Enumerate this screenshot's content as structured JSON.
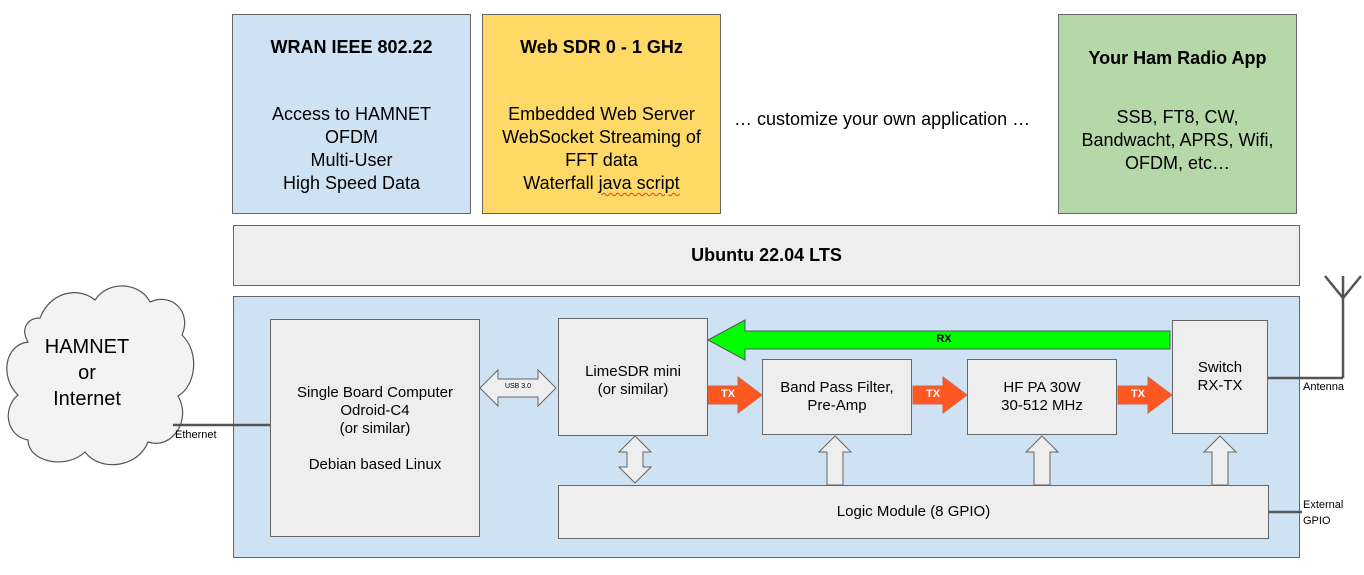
{
  "apps": {
    "wran": {
      "title": "WRAN IEEE 802.22",
      "lines": [
        "Access to HAMNET",
        "OFDM",
        "Multi-User",
        "High Speed Data"
      ],
      "color": "#cfe2f3"
    },
    "websdr": {
      "title": "Web SDR 0 - 1 GHz",
      "lines": [
        "Embedded Web Server",
        "WebSocket Streaming of",
        "FFT data"
      ],
      "last_prefix": "Waterfall ",
      "last_squiggle": "java script",
      "color": "#ffd966"
    },
    "custom_text": "… customize your own application …",
    "ham": {
      "title": "Your Ham Radio App",
      "lines": [
        "SSB, FT8, CW,",
        "Bandwacht, APRS, Wifi,",
        "OFDM, etc…"
      ],
      "color": "#b6d7a8"
    }
  },
  "os": {
    "label": "Ubuntu 22.04 LTS"
  },
  "cloud": {
    "lines": [
      "HAMNET",
      "or",
      "Internet"
    ]
  },
  "hardware": {
    "background": "#cfe2f3",
    "sbc": {
      "lines": [
        "Single Board Computer",
        "Odroid-C4",
        "(or similar)",
        "",
        "Debian based Linux"
      ]
    },
    "limesdr": {
      "lines": [
        "LimeSDR mini",
        "(or similar)"
      ]
    },
    "bpf": {
      "lines": [
        "Band Pass Filter,",
        "Pre-Amp"
      ]
    },
    "pa": {
      "lines": [
        "HF PA 30W",
        "30-512 MHz"
      ]
    },
    "switch": {
      "lines": [
        "Switch",
        "RX-TX"
      ]
    },
    "logic": {
      "label": "Logic Module (8 GPIO)"
    }
  },
  "arrows": {
    "usb": "USB 3.0",
    "rx": "RX",
    "tx": "TX",
    "rx_color": "#00ff00",
    "tx_color": "#ff5722"
  },
  "labels": {
    "ethernet": "Ethernet",
    "antenna": "Antenna",
    "external_gpio_1": "External",
    "external_gpio_2": "GPIO"
  }
}
